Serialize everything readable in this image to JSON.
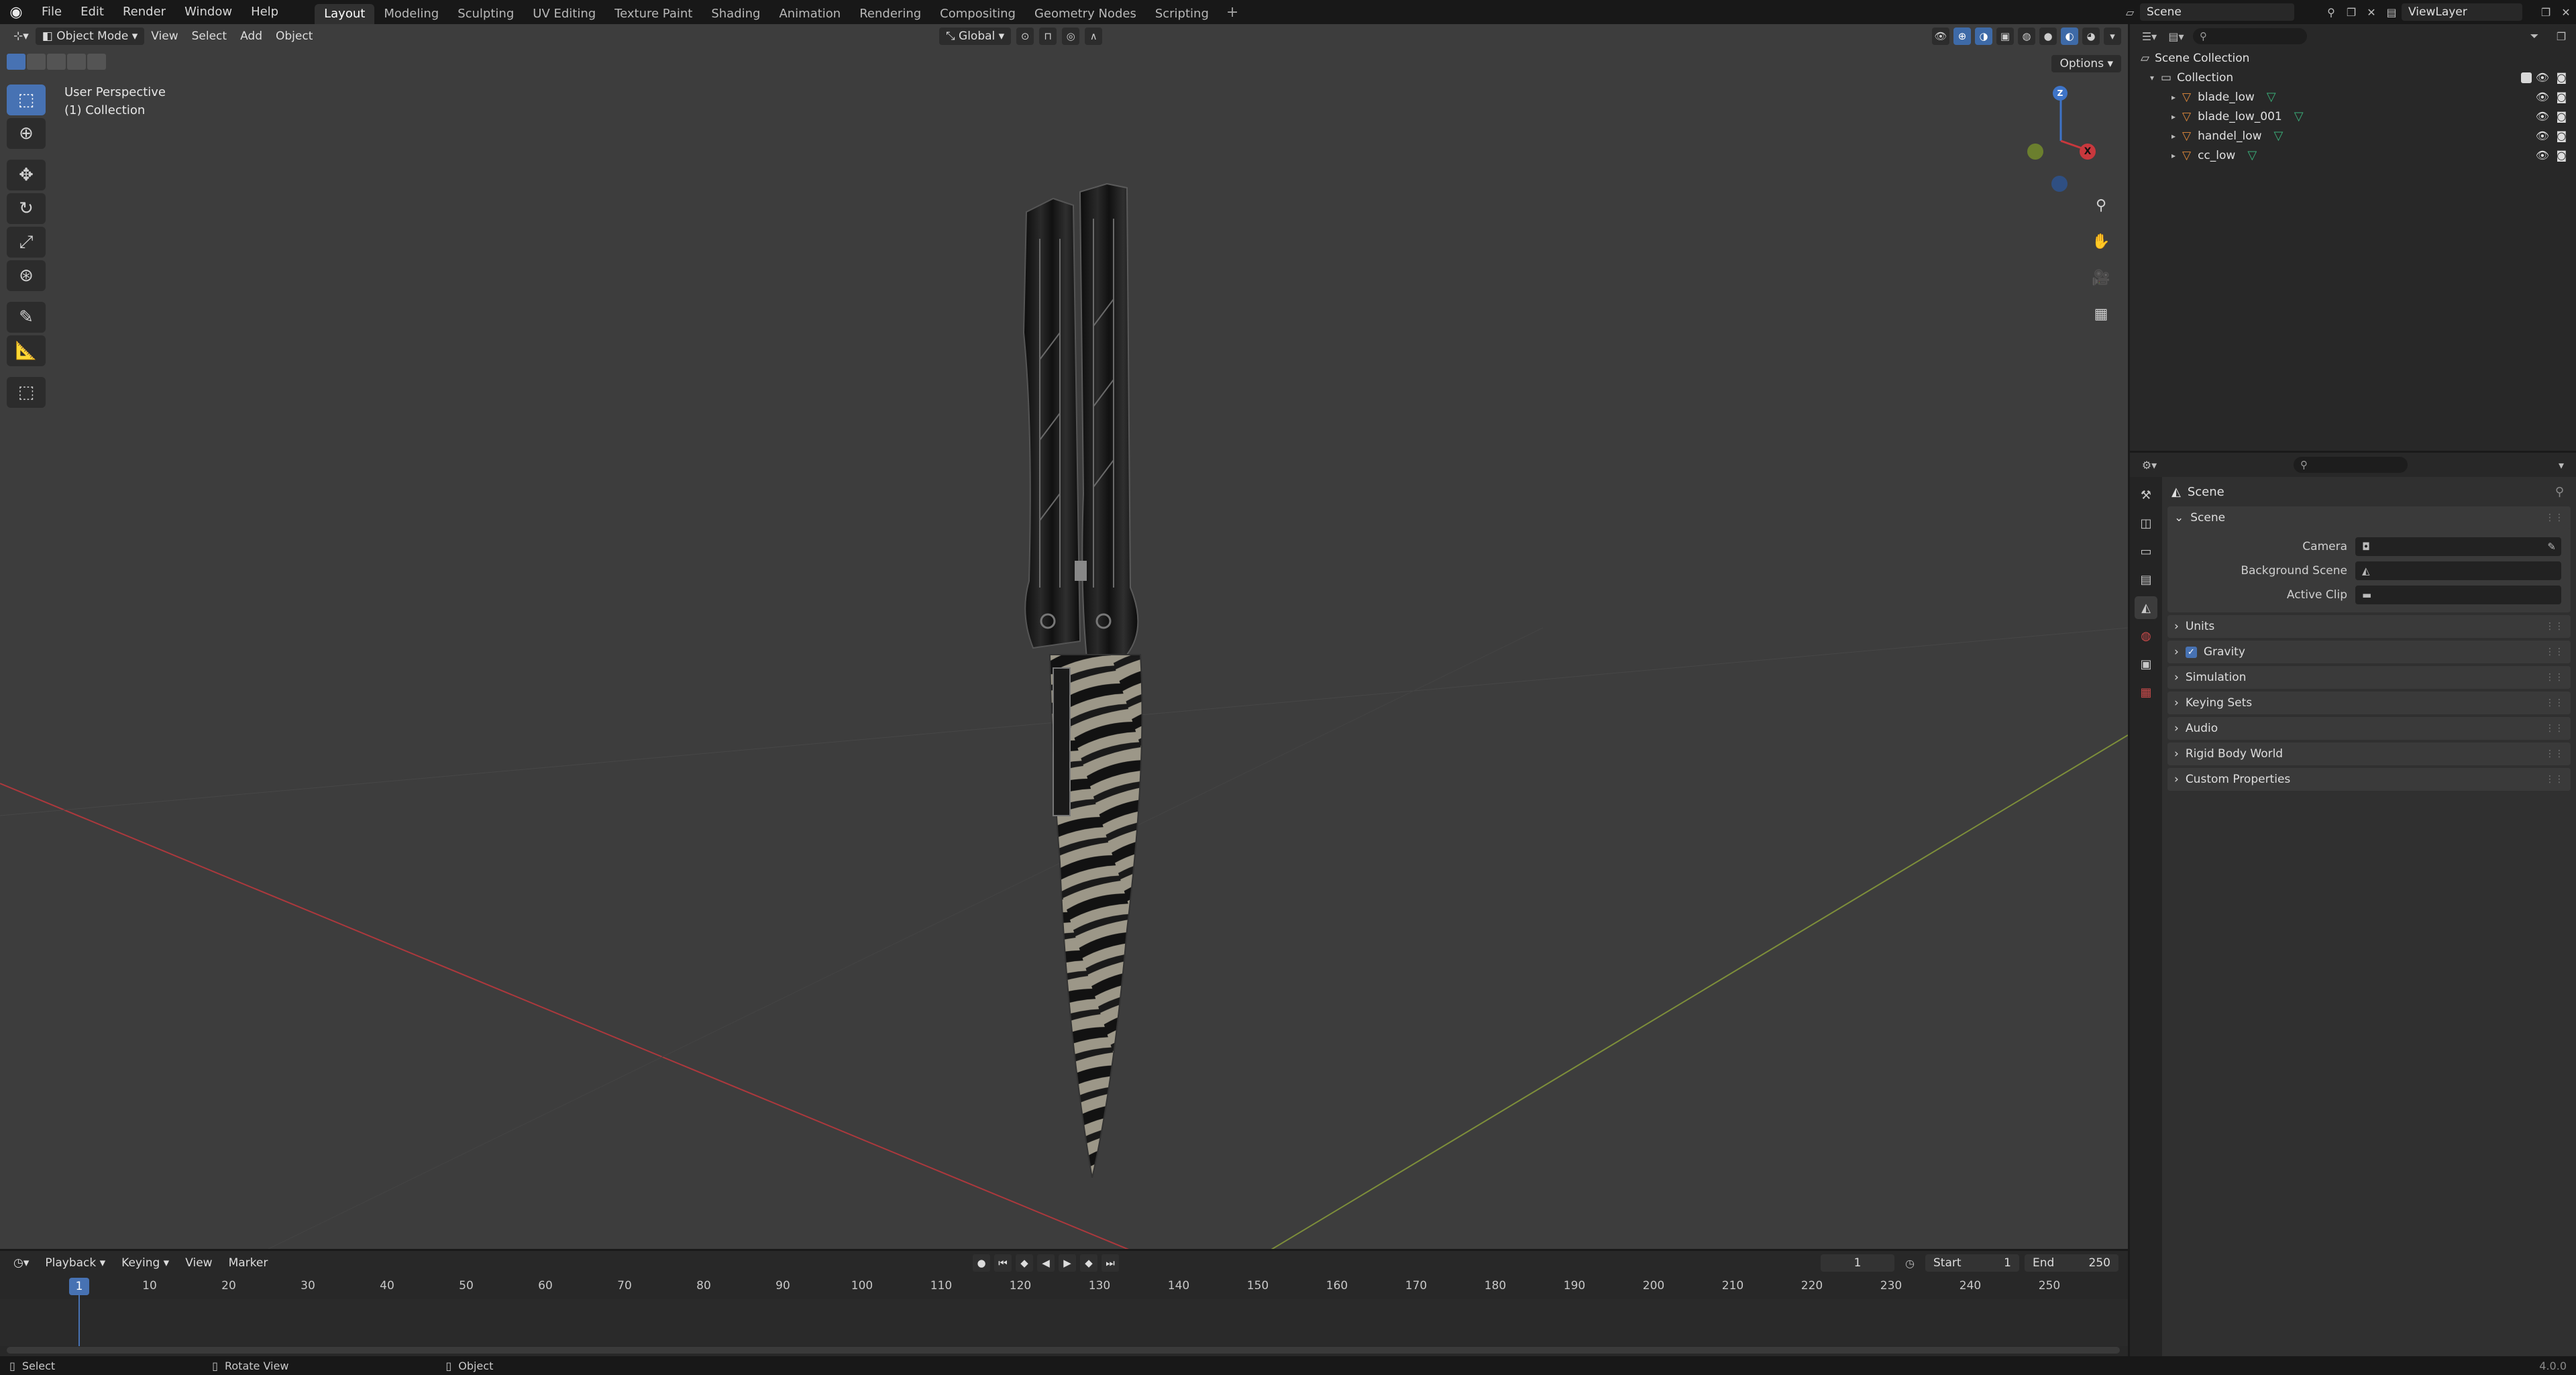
{
  "menu": [
    "File",
    "Edit",
    "Render",
    "Window",
    "Help"
  ],
  "workspaces": [
    "Layout",
    "Modeling",
    "Sculpting",
    "UV Editing",
    "Texture Paint",
    "Shading",
    "Animation",
    "Rendering",
    "Compositing",
    "Geometry Nodes",
    "Scripting"
  ],
  "active_workspace": "Layout",
  "scene_name": "Scene",
  "view_layer": "ViewLayer",
  "viewport": {
    "mode": "Object Mode",
    "menus": [
      "View",
      "Select",
      "Add",
      "Object"
    ],
    "orientation": "Global",
    "options_label": "Options",
    "perspective": "User Perspective",
    "collection": "(1) Collection",
    "gizmo": {
      "z": "Z",
      "x": "X"
    }
  },
  "outliner": {
    "root": "Scene Collection",
    "collection": "Collection",
    "objects": [
      "blade_low",
      "blade_low_001",
      "handel_low",
      "cc_low"
    ]
  },
  "properties": {
    "title": "Scene",
    "panel_scene": "Scene",
    "fields": [
      {
        "label": "Camera",
        "value": ""
      },
      {
        "label": "Background Scene",
        "value": ""
      },
      {
        "label": "Active Clip",
        "value": ""
      }
    ],
    "panels": [
      "Units",
      "Gravity",
      "Simulation",
      "Keying Sets",
      "Audio",
      "Rigid Body World",
      "Custom Properties"
    ]
  },
  "timeline": {
    "menus": [
      "Playback",
      "Keying",
      "View",
      "Marker"
    ],
    "current_frame": "1",
    "start_label": "Start",
    "start": "1",
    "end_label": "End",
    "end": "250",
    "ruler": [
      "10",
      "20",
      "30",
      "40",
      "50",
      "60",
      "70",
      "80",
      "90",
      "100",
      "110",
      "120",
      "130",
      "140",
      "150",
      "160",
      "170",
      "180",
      "190",
      "200",
      "210",
      "220",
      "230",
      "240",
      "250"
    ]
  },
  "status": {
    "select": "Select",
    "rotate": "Rotate View",
    "object": "Object",
    "version": "4.0.0"
  },
  "colors": {
    "accent": "#4772b3",
    "x_axis": "#c8383d",
    "y_axis": "#8ea33a",
    "z_axis": "#3e74c8",
    "mesh": "#e38a3a"
  }
}
